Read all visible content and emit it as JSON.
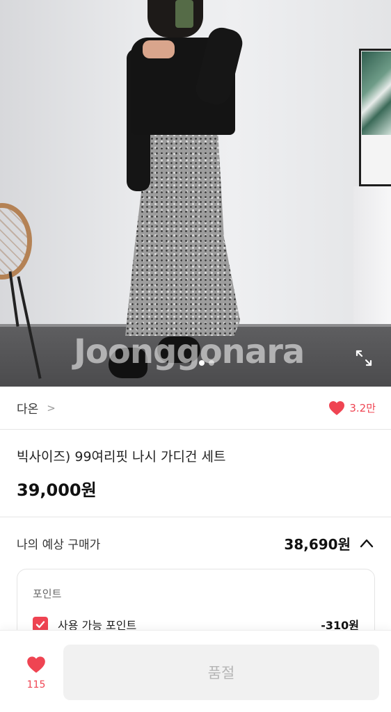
{
  "hero": {
    "watermark": "Joonggonara",
    "image_count": 2,
    "active_image_index": 1
  },
  "seller": {
    "name": "다온",
    "chevron": ">"
  },
  "likes": {
    "count": "3.2만",
    "icon": "heart-icon"
  },
  "product": {
    "title": "빅사이즈) 99여리핏 나시 가디건 세트",
    "price": "39,000원"
  },
  "expected_price": {
    "label": "나의 예상 구매가",
    "value": "38,690원",
    "expanded": true
  },
  "points": {
    "title": "포인트",
    "items": [
      {
        "label": "사용 가능 포인트",
        "value": "-310원",
        "checked": true
      }
    ]
  },
  "bottom": {
    "wish_count": "115",
    "button_label": "품절"
  },
  "colors": {
    "accent": "#ef4452",
    "button_bg": "#f1f1f1",
    "button_text": "#b5b5b5"
  }
}
